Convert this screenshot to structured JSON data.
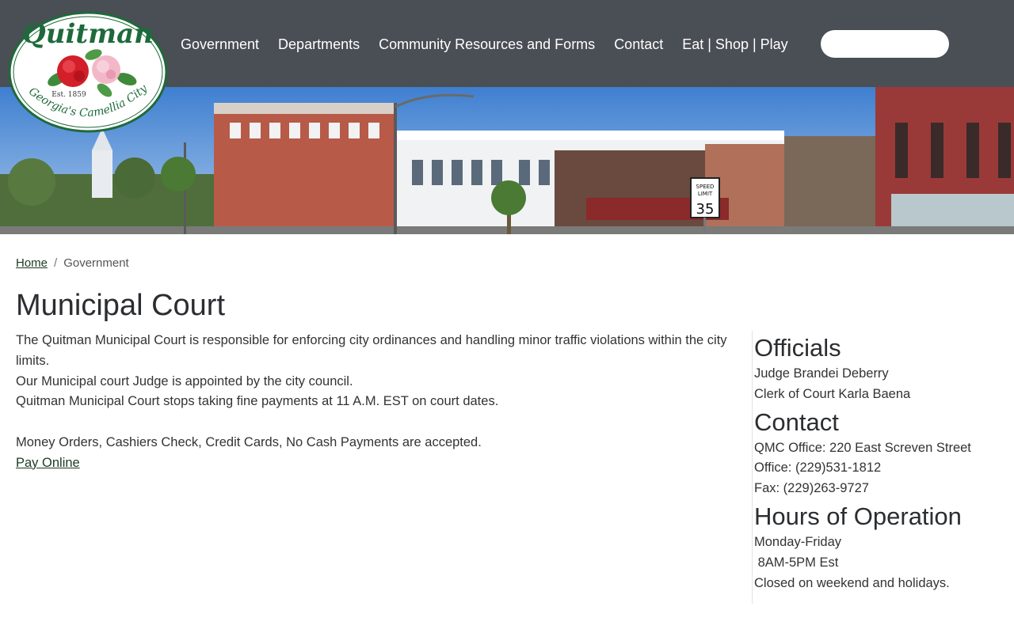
{
  "logo": {
    "name": "Quitman",
    "established": "Est. 1859",
    "tagline": "Georgia's Camellia City"
  },
  "nav": {
    "items": [
      {
        "label": "Government"
      },
      {
        "label": "Departments"
      },
      {
        "label": "Community Resources and Forms"
      },
      {
        "label": "Contact"
      },
      {
        "label": "Eat | Shop | Play"
      }
    ]
  },
  "search": {
    "value": "",
    "placeholder": ""
  },
  "banner": {
    "speed_sign_top": "SPEED",
    "speed_sign_mid": "LIMIT",
    "speed_sign_num": "35"
  },
  "breadcrumb": {
    "home": "Home",
    "separator": "/",
    "current": "Government"
  },
  "page": {
    "title": "Municipal Court",
    "paragraph_1": "The Quitman Municipal Court is responsible for enforcing city ordinances and handling minor traffic violations within the city limits.",
    "paragraph_2": "Our Municipal court Judge is appointed by the city council.",
    "paragraph_3": "Quitman Municipal Court stops taking fine payments at 11 A.M. EST on court dates.",
    "paragraph_4": "Money Orders, Cashiers Check, Credit Cards, No Cash Payments are accepted.",
    "pay_link": "Pay Online"
  },
  "sidebar": {
    "officials_title": "Officials",
    "officials": [
      "Judge Brandei Deberry",
      "Clerk of Court Karla Baena"
    ],
    "contact_title": "Contact",
    "contact": [
      "QMC Office: 220 East Screven Street",
      "Office: (229)531-1812",
      "Fax: (229)263-9727"
    ],
    "hours_title": "Hours of Operation",
    "hours": [
      "Monday-Friday",
      " 8AM-5PM Est",
      "Closed on weekend and holidays."
    ]
  },
  "colors": {
    "header_bg": "#4a4e55",
    "logo_green": "#1e6a3a",
    "link_green": "#1d3a24"
  }
}
